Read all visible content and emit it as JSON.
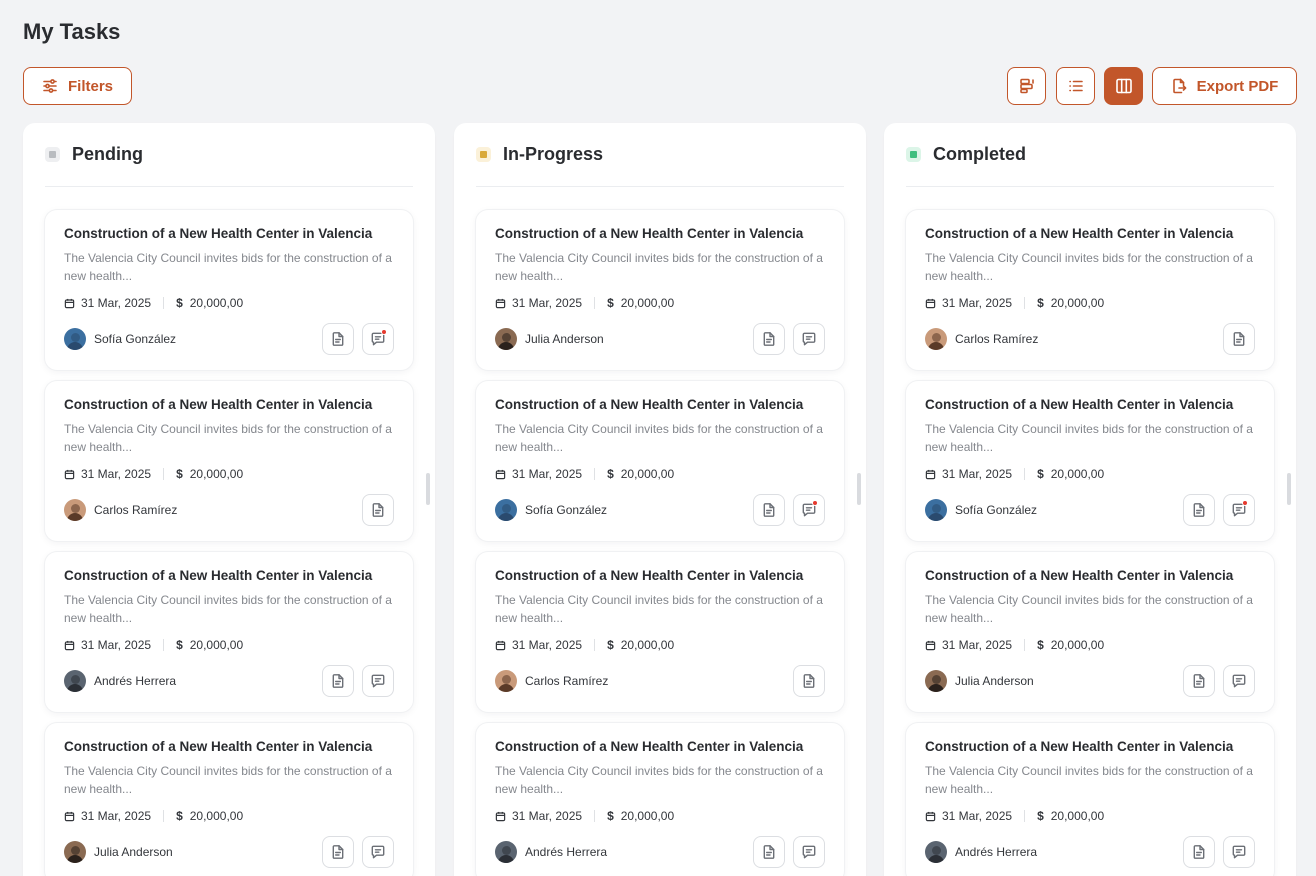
{
  "page": {
    "title": "My Tasks"
  },
  "toolbar": {
    "filters_label": "Filters",
    "export_label": "Export PDF",
    "views": [
      {
        "name": "timeline-view-icon",
        "active": false
      },
      {
        "name": "list-view-icon",
        "active": false
      },
      {
        "name": "board-view-icon",
        "active": true
      }
    ]
  },
  "colors": {
    "accent": "#c2562a",
    "pending": "#c9cbce",
    "in_progress": "#d9a93a",
    "completed": "#3fbf7f",
    "notification": "#e5392e"
  },
  "columns": [
    {
      "title": "Pending",
      "status_color": "#b9bcc0",
      "status_bg": "#eeeff1",
      "cards": [
        {
          "title": "Construction of a New Health Center in Valencia",
          "description": "The Valencia City Council invites bids for the construction of a new health...",
          "date": "31 Mar, 2025",
          "currency": "$",
          "amount": "20,000,00",
          "assignee": "Sofía González",
          "avatar_skin": "#3b6fa0",
          "avatar_hair": "#2a4a6e",
          "has_doc": true,
          "has_chat": true,
          "chat_notification": true
        },
        {
          "title": "Construction of a New Health Center in Valencia",
          "description": "The Valencia City Council invites bids for the construction of a new health...",
          "date": "31 Mar, 2025",
          "currency": "$",
          "amount": "20,000,00",
          "assignee": "Carlos Ramírez",
          "avatar_skin": "#c99a7a",
          "avatar_hair": "#5a3a28",
          "has_doc": true,
          "has_chat": false,
          "chat_notification": false
        },
        {
          "title": "Construction of a New Health Center in Valencia",
          "description": "The Valencia City Council invites bids for the construction of a new health...",
          "date": "31 Mar, 2025",
          "currency": "$",
          "amount": "20,000,00",
          "assignee": "Andrés Herrera",
          "avatar_skin": "#5a6470",
          "avatar_hair": "#2b2f36",
          "has_doc": true,
          "has_chat": true,
          "chat_notification": false
        },
        {
          "title": "Construction of a New Health Center in Valencia",
          "description": "The Valencia City Council invites bids for the construction of a new health...",
          "date": "31 Mar, 2025",
          "currency": "$",
          "amount": "20,000,00",
          "assignee": "Julia Anderson",
          "avatar_skin": "#8a6a52",
          "avatar_hair": "#2a211c",
          "has_doc": true,
          "has_chat": true,
          "chat_notification": false
        }
      ]
    },
    {
      "title": "In-Progress",
      "status_color": "#d9a93a",
      "status_bg": "#fbf1d9",
      "cards": [
        {
          "title": "Construction of a New Health Center in Valencia",
          "description": "The Valencia City Council invites bids for the construction of a new health...",
          "date": "31 Mar, 2025",
          "currency": "$",
          "amount": "20,000,00",
          "assignee": "Julia Anderson",
          "avatar_skin": "#8a6a52",
          "avatar_hair": "#2a211c",
          "has_doc": true,
          "has_chat": true,
          "chat_notification": false
        },
        {
          "title": "Construction of a New Health Center in Valencia",
          "description": "The Valencia City Council invites bids for the construction of a new health...",
          "date": "31 Mar, 2025",
          "currency": "$",
          "amount": "20,000,00",
          "assignee": "Sofía González",
          "avatar_skin": "#3b6fa0",
          "avatar_hair": "#2a4a6e",
          "has_doc": true,
          "has_chat": true,
          "chat_notification": true
        },
        {
          "title": "Construction of a New Health Center in Valencia",
          "description": "The Valencia City Council invites bids for the construction of a new health...",
          "date": "31 Mar, 2025",
          "currency": "$",
          "amount": "20,000,00",
          "assignee": "Carlos Ramírez",
          "avatar_skin": "#c99a7a",
          "avatar_hair": "#5a3a28",
          "has_doc": true,
          "has_chat": false,
          "chat_notification": false
        },
        {
          "title": "Construction of a New Health Center in Valencia",
          "description": "The Valencia City Council invites bids for the construction of a new health...",
          "date": "31 Mar, 2025",
          "currency": "$",
          "amount": "20,000,00",
          "assignee": "Andrés Herrera",
          "avatar_skin": "#5a6470",
          "avatar_hair": "#2b2f36",
          "has_doc": true,
          "has_chat": true,
          "chat_notification": false
        }
      ]
    },
    {
      "title": "Completed",
      "status_color": "#3fbf7f",
      "status_bg": "#dcf5e8",
      "cards": [
        {
          "title": "Construction of a New Health Center in Valencia",
          "description": "The Valencia City Council invites bids for the construction of a new health...",
          "date": "31 Mar, 2025",
          "currency": "$",
          "amount": "20,000,00",
          "assignee": "Carlos Ramírez",
          "avatar_skin": "#c99a7a",
          "avatar_hair": "#5a3a28",
          "has_doc": true,
          "has_chat": false,
          "chat_notification": false
        },
        {
          "title": "Construction of a New Health Center in Valencia",
          "description": "The Valencia City Council invites bids for the construction of a new health...",
          "date": "31 Mar, 2025",
          "currency": "$",
          "amount": "20,000,00",
          "assignee": "Sofía González",
          "avatar_skin": "#3b6fa0",
          "avatar_hair": "#2a4a6e",
          "has_doc": true,
          "has_chat": true,
          "chat_notification": true
        },
        {
          "title": "Construction of a New Health Center in Valencia",
          "description": "The Valencia City Council invites bids for the construction of a new health...",
          "date": "31 Mar, 2025",
          "currency": "$",
          "amount": "20,000,00",
          "assignee": "Julia Anderson",
          "avatar_skin": "#8a6a52",
          "avatar_hair": "#2a211c",
          "has_doc": true,
          "has_chat": true,
          "chat_notification": false
        },
        {
          "title": "Construction of a New Health Center in Valencia",
          "description": "The Valencia City Council invites bids for the construction of a new health...",
          "date": "31 Mar, 2025",
          "currency": "$",
          "amount": "20,000,00",
          "assignee": "Andrés Herrera",
          "avatar_skin": "#5a6470",
          "avatar_hair": "#2b2f36",
          "has_doc": true,
          "has_chat": true,
          "chat_notification": false
        }
      ]
    }
  ]
}
